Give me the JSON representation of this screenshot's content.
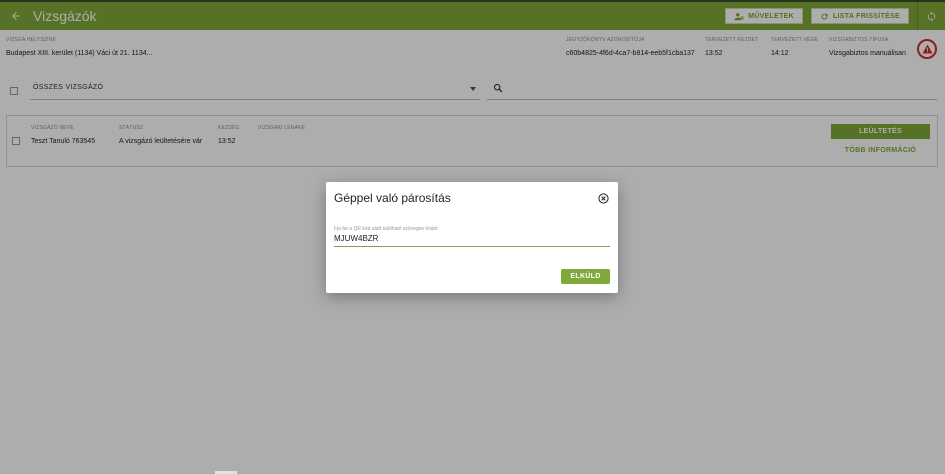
{
  "appbar": {
    "title": "Vizsgázók",
    "actions_label": "MŰVELETEK",
    "refresh_label": "LISTA FRISSÍTÉSE"
  },
  "info": {
    "location_label": "VIZSGA HELYSZÍNE",
    "location_value": "Budapest XIII. kerület (1134) Váci út 21. 1134...",
    "protocol_label": "JEGYZŐKÖNYV AZONOSÍTÓJA",
    "protocol_value": "c60b4825-4f6d-4ca7-b814-eeb5f1cba137",
    "planned_start_label": "TERVEZETT KEZDET",
    "planned_start_value": "13:52",
    "planned_end_label": "TERVEZETT VÉGE",
    "planned_end_value": "14:12",
    "examiner_type_label": "VIZSGABIZTOS TÍPUSA",
    "examiner_type_value": "Vizsgabiztos manuálisan"
  },
  "filter": {
    "select_value": "ÖSSZES VIZSGÁZÓ"
  },
  "table": {
    "headers": [
      "VIZSGÁZÓ NEVE",
      "STÁTUSZ",
      "KEZDÉS",
      "VIZSGAKI LÉNAKE"
    ],
    "rows": [
      {
        "name": "Teszt Tanuló 763545",
        "status": "A vizsgázó leültetésére vár",
        "start": "13:52",
        "extra": ""
      }
    ],
    "seat_button": "LEÜLTETÉS",
    "more_info": "TÖBB INFORMÁCIÓ"
  },
  "dialog": {
    "title": "Géppel való párosítás",
    "field_label": "Írja be a QR kód alatt található szöveges kódot",
    "field_value": "MJUW4BZR",
    "submit_label": "ELKÜLD"
  },
  "colors": {
    "brand": "#7fa83a",
    "danger": "#d32f2f"
  }
}
